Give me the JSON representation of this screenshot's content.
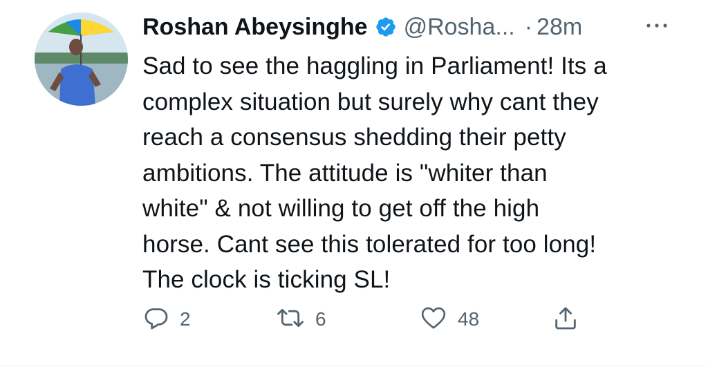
{
  "author": {
    "name": "Roshan Abeysinghe",
    "handle": "@Rosha...",
    "separator": "·",
    "time": "28m"
  },
  "body": {
    "lines": [
      "Sad to see the haggling in Parliament! Its a",
      "complex situation but surely why cant they",
      "reach a consensus shedding their petty",
      "ambitions. The attitude is \"whiter than",
      "white\" & not willing to get off the high",
      "horse. Cant see this tolerated for too long!",
      "The clock is ticking SL!"
    ]
  },
  "actions": {
    "reply_count": "2",
    "retweet_count": "6",
    "like_count": "48"
  },
  "icons": {
    "verified": "verified-badge-icon",
    "more": "more-dots-icon",
    "reply": "reply-bubble-icon",
    "retweet": "retweet-icon",
    "like": "heart-icon",
    "share": "share-icon"
  },
  "colors": {
    "text": "#0f1419",
    "secondary": "#536471",
    "verified": "#1d9bf0"
  }
}
